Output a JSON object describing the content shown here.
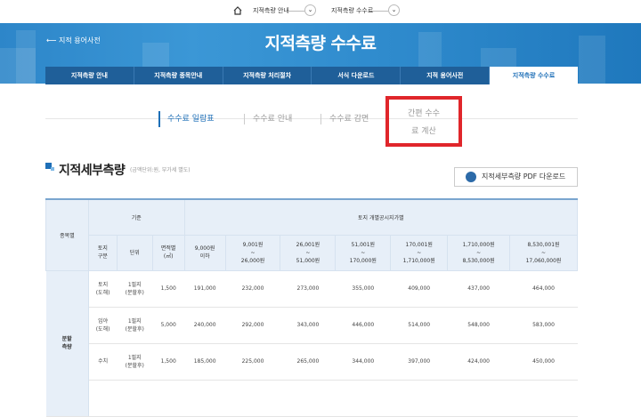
{
  "topnav": {
    "crumb1": "지적측량 안내",
    "crumb2": "지적측량 수수료"
  },
  "banner": {
    "back_label": "지적 용어사전",
    "title": "지적측량 수수료"
  },
  "tabs": [
    {
      "label": "지적측량 안내",
      "active": false
    },
    {
      "label": "지적측량 종목안내",
      "active": false
    },
    {
      "label": "지적측량 처리절차",
      "active": false
    },
    {
      "label": "서식 다운로드",
      "active": false
    },
    {
      "label": "지적 용어사전",
      "active": false
    },
    {
      "label": "지적측량 수수료",
      "active": true
    }
  ],
  "subtabs": {
    "item1": "수수료 일람표",
    "item2": "수수료 안내",
    "item3": "수수료 감면",
    "item4_line1": "간편 수수",
    "item4_line2": "료 계산"
  },
  "section": {
    "title": "지적세부측량",
    "note": "(금액단위:원, 부가세 별도)"
  },
  "pdf_button": {
    "label": "지적세부측량 PDF 다운로드",
    "icon": "download-icon"
  },
  "table": {
    "h_type": "종목별",
    "h_basis": "기준",
    "h_land": "토지 개별공시지가별",
    "basis_cols": [
      [
        "토지",
        "구분"
      ],
      [
        "단위"
      ],
      [
        "면적별",
        "(㎡)"
      ]
    ],
    "price_cols": [
      [
        "9,000원",
        "이하"
      ],
      [
        "9,001원",
        "~",
        "26,000원"
      ],
      [
        "26,001원",
        "~",
        "51,000원"
      ],
      [
        "51,001원",
        "~",
        "170,000원"
      ],
      [
        "170,001원",
        "~",
        "1,710,000원"
      ],
      [
        "1,710,000원",
        "~",
        "8,530,000원"
      ],
      [
        "8,530,001원",
        "~",
        "17,060,000원"
      ]
    ],
    "group_label": [
      "분할",
      "측량"
    ],
    "rows": [
      {
        "type": [
          "토지",
          "(도해)"
        ],
        "unit": [
          "1필지",
          "(분할후)"
        ],
        "area": "1,500",
        "values": [
          "191,000",
          "232,000",
          "273,000",
          "355,000",
          "409,000",
          "437,000",
          "464,000"
        ]
      },
      {
        "type": [
          "임야",
          "(도해)"
        ],
        "unit": [
          "1필지",
          "(분할후)"
        ],
        "area": "5,000",
        "values": [
          "240,000",
          "292,000",
          "343,000",
          "446,000",
          "514,000",
          "548,000",
          "583,000"
        ]
      },
      {
        "type": [
          "수치"
        ],
        "unit": [
          "1필지",
          "(분할후)"
        ],
        "area": "1,500",
        "values": [
          "185,000",
          "225,000",
          "265,000",
          "344,000",
          "397,000",
          "424,000",
          "450,000"
        ]
      }
    ]
  }
}
